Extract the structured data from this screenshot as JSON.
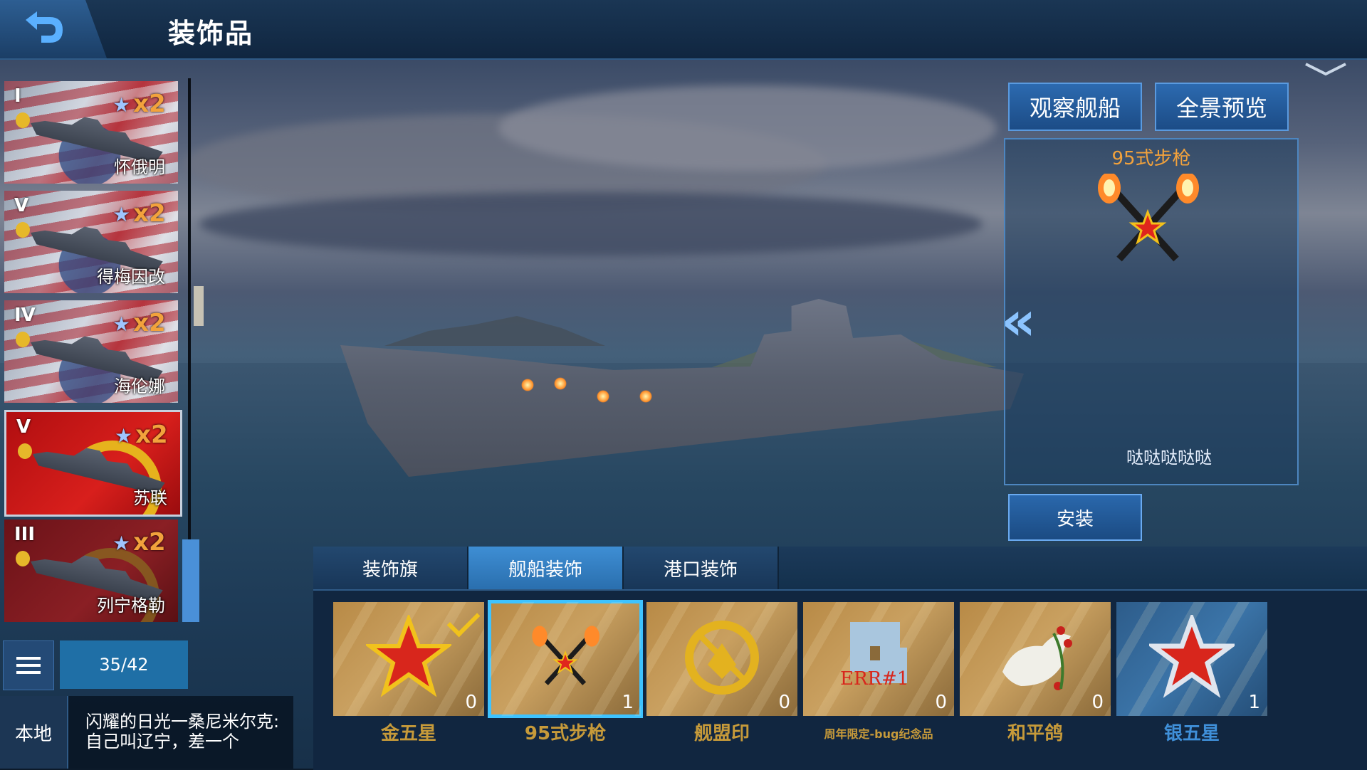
{
  "header": {
    "title": "装饰品",
    "back_icon": "back-arrow-icon"
  },
  "ships": [
    {
      "tier": "I",
      "count": "x2",
      "name": "怀俄明",
      "flag": "usa"
    },
    {
      "tier": "V",
      "count": "x2",
      "name": "得梅因改",
      "flag": "usa"
    },
    {
      "tier": "IV",
      "count": "x2",
      "name": "海伦娜",
      "flag": "usa"
    },
    {
      "tier": "V",
      "count": "x2",
      "name": "苏联",
      "flag": "ussr",
      "selected": true
    },
    {
      "tier": "III",
      "count": "x2",
      "name": "列宁格勒",
      "flag": "ussr"
    }
  ],
  "list_controls": {
    "page_count": "35/42",
    "local_tab": "本地"
  },
  "chat": {
    "text": "闪耀的日光一桑尼米尔克:\n自己叫辽宁，差一个"
  },
  "actions": {
    "observe_ship": "观察舰船",
    "panorama": "全景预览",
    "install": "安装"
  },
  "preview": {
    "title": "95式步枪",
    "description": "哒哒哒哒哒"
  },
  "tabs": [
    {
      "label": "装饰旗",
      "active": false
    },
    {
      "label": "舰船装饰",
      "active": true
    },
    {
      "label": "港口装饰",
      "active": false
    }
  ],
  "items": [
    {
      "name": "金五星",
      "count": "0",
      "icon": "gold-star-icon",
      "equipped": true,
      "style": "gold"
    },
    {
      "name": "95式步枪",
      "count": "1",
      "icon": "rifle-icon",
      "selected": true,
      "style": "gold"
    },
    {
      "name": "舰盟印",
      "count": "0",
      "icon": "alliance-seal-icon",
      "style": "gold"
    },
    {
      "name": "周年限定-bug纪念品",
      "count": "0",
      "icon": "error-bug-icon",
      "icon_text": "ERR#1",
      "style": "gold"
    },
    {
      "name": "和平鸽",
      "count": "0",
      "icon": "peace-dove-icon",
      "style": "gold"
    },
    {
      "name": "银五星",
      "count": "1",
      "icon": "silver-star-icon",
      "style": "blue"
    }
  ],
  "colors": {
    "accent_blue": "#3ec3ff",
    "gold_text": "#c69a3a",
    "count_orange": "#f2a23c"
  }
}
